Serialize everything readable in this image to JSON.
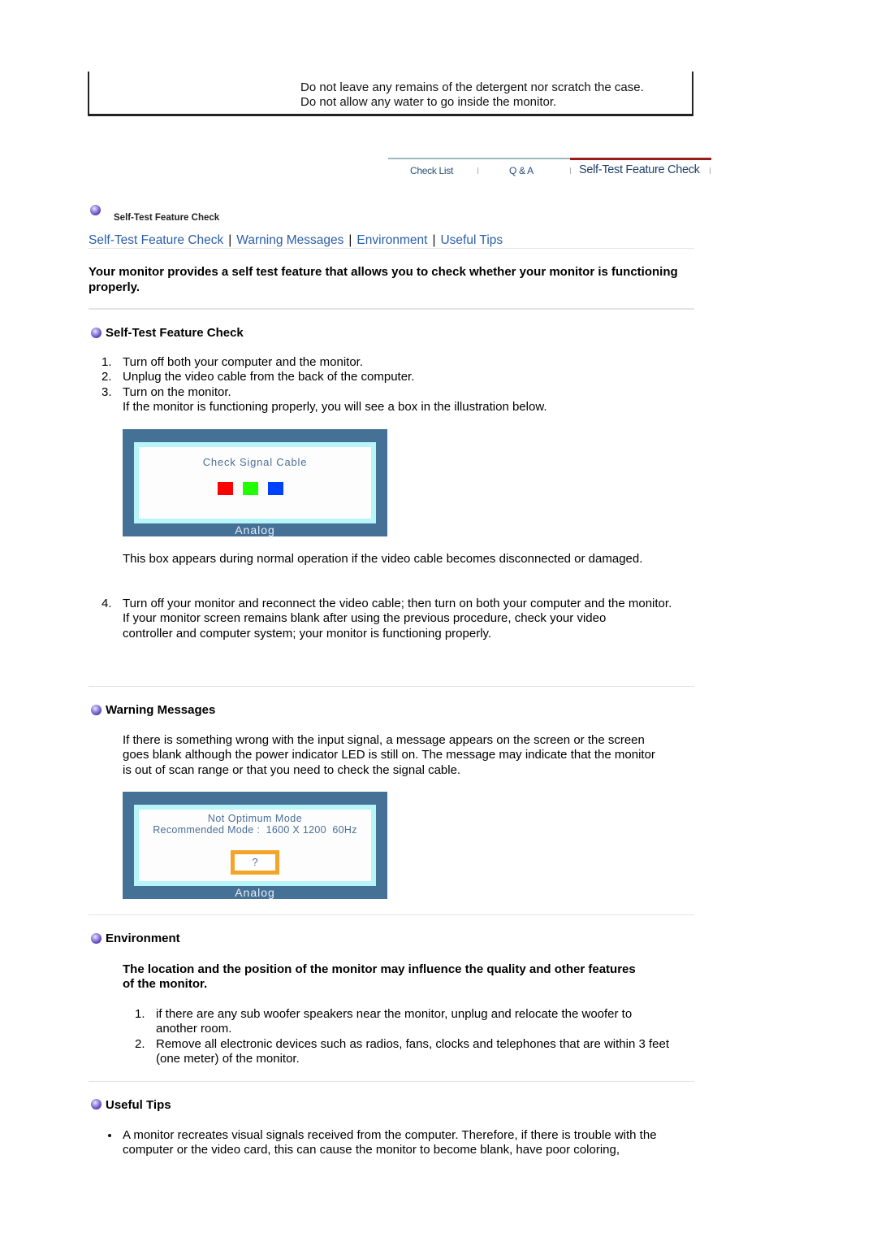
{
  "top_box": {
    "lines": [
      "Do not leave any remains of the detergent nor scratch the case.",
      "Do not allow any water to go inside the monitor."
    ]
  },
  "tabs": [
    {
      "label": "Check List",
      "active": false
    },
    {
      "label": "Q & A",
      "active": false
    },
    {
      "label": "Self-Test Feature Check",
      "active": true
    }
  ],
  "page_title": "Self-Test Feature Check",
  "nav_links": [
    "Self-Test Feature Check",
    "Warning Messages",
    "Environment",
    "Useful Tips"
  ],
  "intro": "Your monitor provides a self test feature that allows you to check whether your monitor is functioning properly.",
  "sections": {
    "self_test": {
      "heading": "Self-Test Feature Check",
      "steps": [
        {
          "num": "1.",
          "text": "Turn off both your computer and the monitor."
        },
        {
          "num": "2.",
          "text": "Unplug the video cable from the back of the computer."
        },
        {
          "num": "3.",
          "text": "Turn on the monitor."
        }
      ],
      "step3_note": "If the monitor is functioning properly, you will see a box in the illustration below.",
      "osd": {
        "message": "Check Signal Cable",
        "footer": "Analog",
        "swatches": [
          "#ff0000",
          "#22ff00",
          "#0040ff"
        ]
      },
      "after_osd": "This box appears during normal operation if the video cable becomes disconnected or damaged.",
      "step4": {
        "num": "4.",
        "text": "Turn off your monitor and reconnect the video cable; then turn on both your computer and the monitor."
      },
      "step4_note": "If your monitor screen remains blank after using the previous procedure, check your video controller and computer system; your monitor is functioning properly."
    },
    "warning": {
      "heading": "Warning Messages",
      "text": "If there is something wrong with the input signal, a message appears on the screen or the screen goes blank although the power indicator LED is still on. The message may indicate that the monitor is out of scan range or that you need to check the signal cable.",
      "osd": {
        "line1": "Not Optimum Mode",
        "line2": "Recommended Mode :  1600 X 1200  60Hz",
        "button": "?",
        "footer": "Analog"
      }
    },
    "environment": {
      "heading": "Environment",
      "lead": "The location and the position of the monitor may influence the quality and other features of the monitor.",
      "items": [
        {
          "num": "1.",
          "text": "if there are any sub woofer speakers near the monitor, unplug and relocate the woofer to another room."
        },
        {
          "num": "2.",
          "text": "Remove all electronic devices such as radios, fans, clocks and telephones that are within 3 feet (one meter) of the monitor."
        }
      ]
    },
    "tips": {
      "heading": "Useful Tips",
      "items": [
        "A monitor recreates visual signals received from the computer. Therefore, if there is trouble with the computer or the video card, this can cause the monitor to become blank, have poor coloring,"
      ]
    }
  }
}
